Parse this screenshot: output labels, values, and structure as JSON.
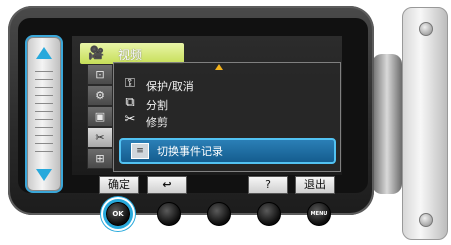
{
  "menu": {
    "tab": {
      "label": "视频",
      "icon": "video-camera-icon"
    },
    "side_tabs": [
      {
        "icon": "connect-icon",
        "glyph": "⊡"
      },
      {
        "icon": "setup-icon",
        "glyph": "⚙"
      },
      {
        "icon": "display-icon",
        "glyph": "▣"
      },
      {
        "icon": "edit-icon",
        "glyph": "✂"
      },
      {
        "icon": "media-icon",
        "glyph": "⊞"
      }
    ],
    "items": [
      {
        "label": "保护/取消",
        "icon": "key-icon",
        "glyph": "⚿"
      },
      {
        "label": "分割",
        "icon": "split-icon",
        "glyph": "⧉"
      },
      {
        "label": "修剪",
        "icon": "trim-icon",
        "glyph": "✂"
      }
    ],
    "selected_item": {
      "label": "切换事件记录",
      "icon": "event-icon",
      "glyph": "≡"
    }
  },
  "buttons": {
    "confirm": "确定",
    "back_glyph": "↩",
    "help": "?",
    "exit": "退出"
  },
  "round_buttons": {
    "ok": "OK",
    "menu": "MENU"
  },
  "colors": {
    "accent": "#27a9dc",
    "tab": "#c6de58",
    "selection": "#155d8f"
  }
}
